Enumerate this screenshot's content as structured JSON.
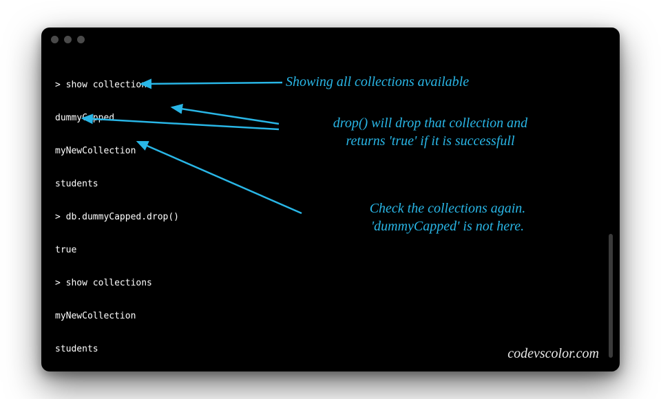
{
  "terminal": {
    "lines": [
      "> show collections",
      "dummyCapped",
      "myNewCollection",
      "students",
      "> db.dummyCapped.drop()",
      "true",
      "> show collections",
      "myNewCollection",
      "students",
      "> "
    ],
    "prompt": ">"
  },
  "annotations": {
    "a1": "Showing all collections available",
    "a2_line1": "drop() will drop that collection and",
    "a2_line2": "returns 'true' if it is successfull",
    "a3_line1": "Check the collections again.",
    "a3_line2": "'dummyCapped' is not here."
  },
  "watermark": "codevscolor.com",
  "colors": {
    "accent": "#29b6e6",
    "terminal_bg": "#000000",
    "terminal_fg": "#ffffff"
  }
}
